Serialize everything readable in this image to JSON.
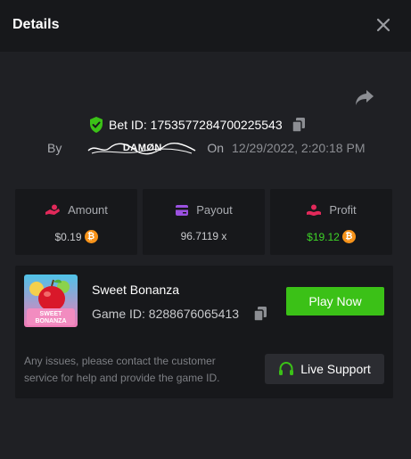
{
  "header": {
    "title": "Details",
    "close_icon": "close-icon"
  },
  "bet": {
    "share_icon": "share-icon",
    "bet_id_label": "Bet ID: 1753577284700225543",
    "by_label": "By",
    "username": "DAMØN",
    "on_label": "On",
    "date": "12/29/2022, 2:20:18 PM"
  },
  "stats": {
    "amount": {
      "label": "Amount",
      "value": "$0.19",
      "icon": "amount-hand-icon",
      "currency_icon": "bitcoin-icon"
    },
    "payout": {
      "label": "Payout",
      "value": "96.7119 x",
      "icon": "card-icon"
    },
    "profit": {
      "label": "Profit",
      "value": "$19.12",
      "icon": "profit-hand-icon",
      "currency_icon": "bitcoin-icon"
    }
  },
  "game": {
    "name": "Sweet Bonanza",
    "thumb_text_1": "SWEET",
    "thumb_text_2": "BONANZA",
    "game_id_label": "Game ID: 8288676065413",
    "play_label": "Play Now",
    "issue_text": "Any issues, please contact the customer service for help and provide the game ID.",
    "support_label": "Live Support",
    "support_icon": "headset-icon"
  },
  "colors": {
    "background": "#1f2024",
    "panel": "#17181b",
    "accent_green": "#3bc117",
    "profit_green": "#3ed428",
    "bitcoin_orange": "#f7931a",
    "icon_red": "#e2295a",
    "icon_purple": "#9b51e0"
  }
}
